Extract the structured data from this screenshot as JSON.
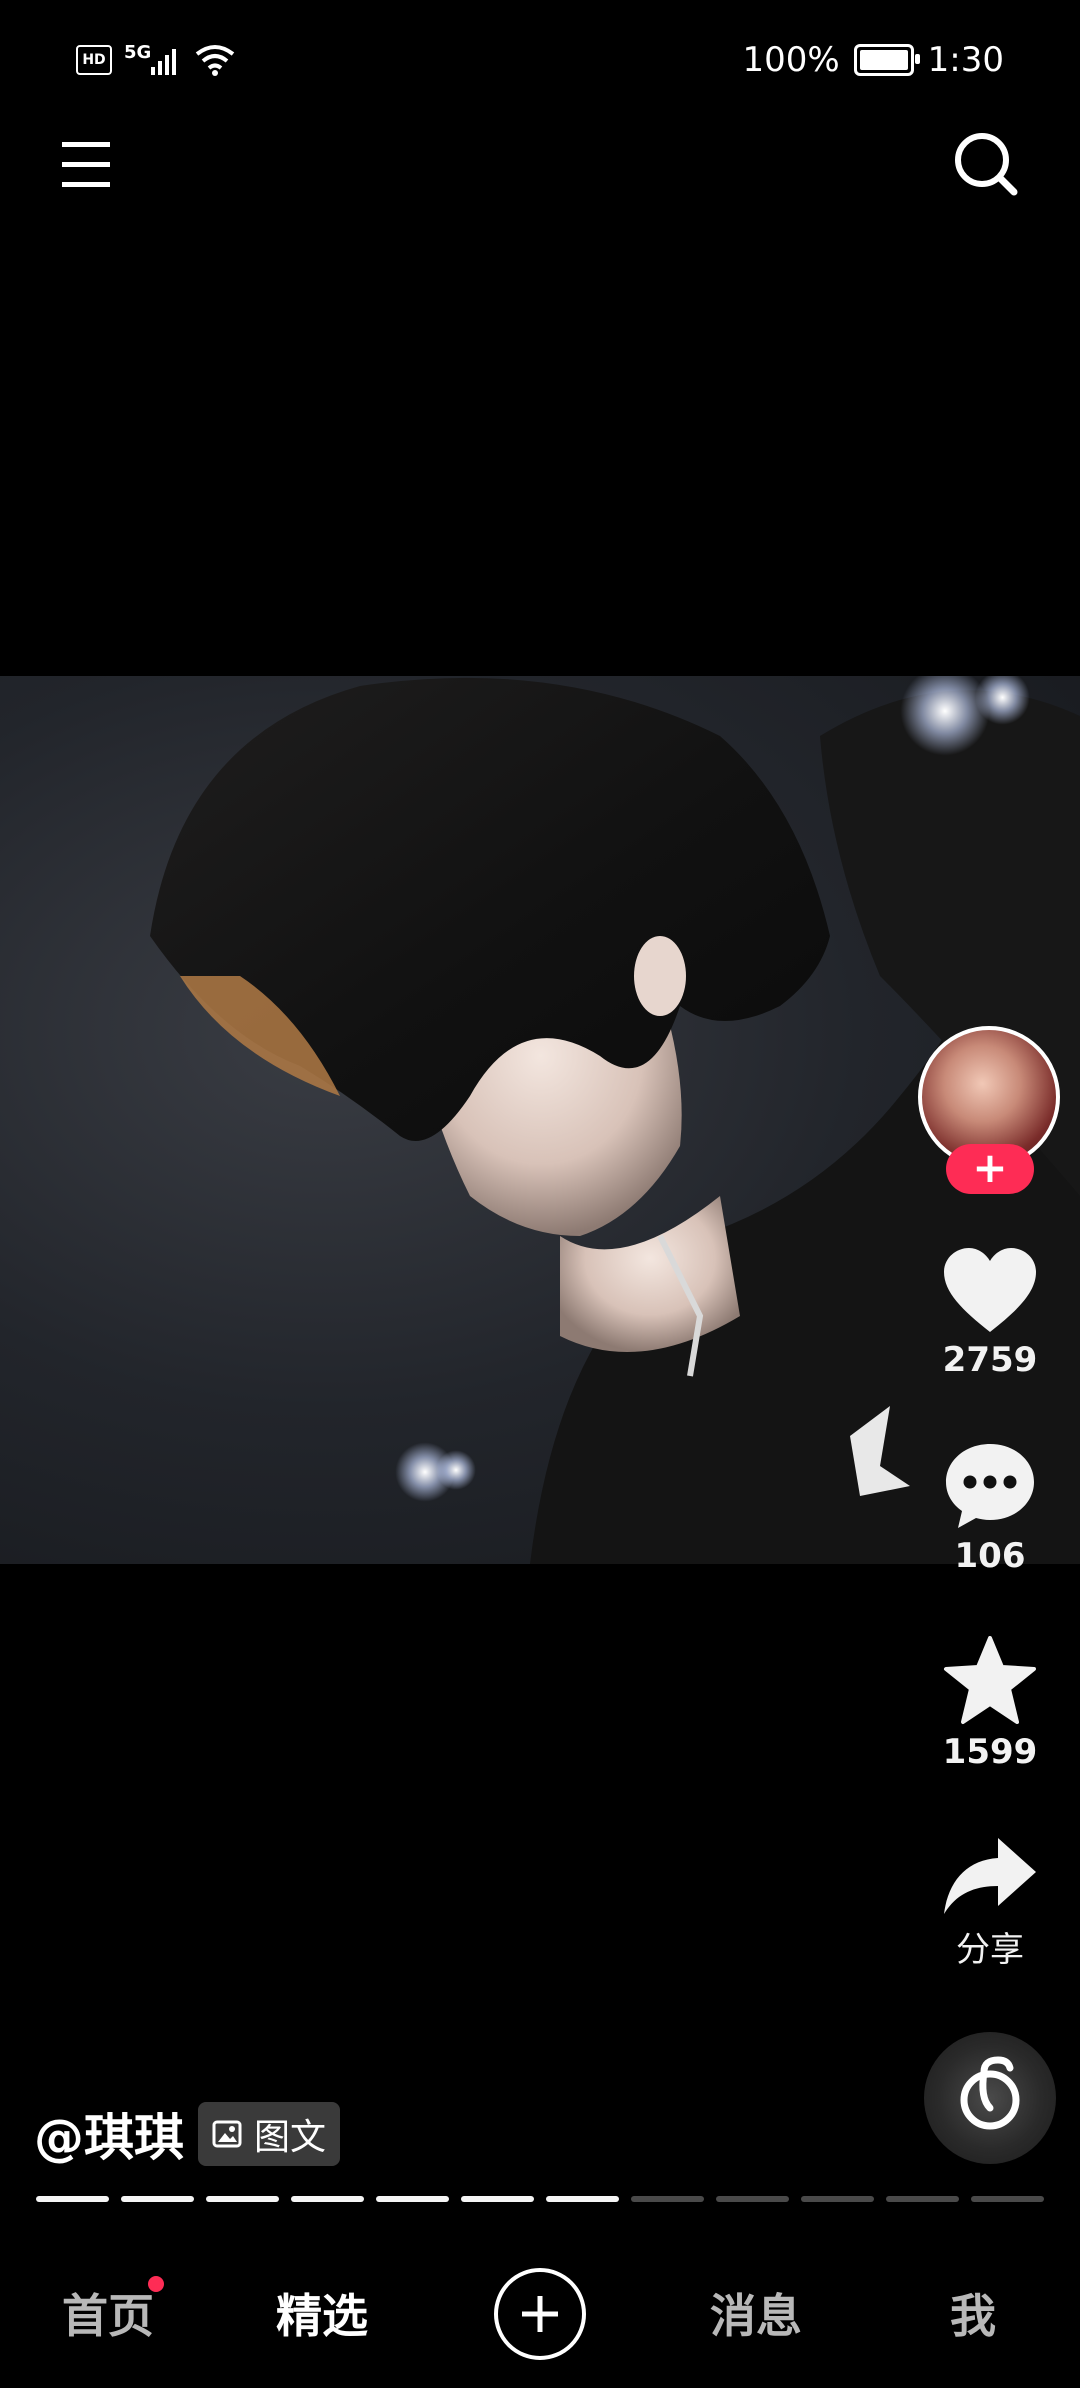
{
  "status_bar": {
    "hd": "HD",
    "network": "5G",
    "battery_percent": "100%",
    "battery_level": 1.0,
    "time": "1:30"
  },
  "top_bar": {
    "menu_icon": "hamburger-menu-icon",
    "search_icon": "search-icon"
  },
  "post": {
    "author": "@琪琪",
    "type_tag": "图文",
    "likes": "2759",
    "comments": "106",
    "favorites": "1599",
    "share_label": "分享",
    "follow_symbol": "+",
    "slides_total": 12,
    "slides_viewed": 7
  },
  "bottom_nav": {
    "home": "首页",
    "featured": "精选",
    "messages": "消息",
    "me": "我",
    "active": "featured"
  },
  "colors": {
    "accent": "#fe2c55",
    "background": "#000000"
  }
}
